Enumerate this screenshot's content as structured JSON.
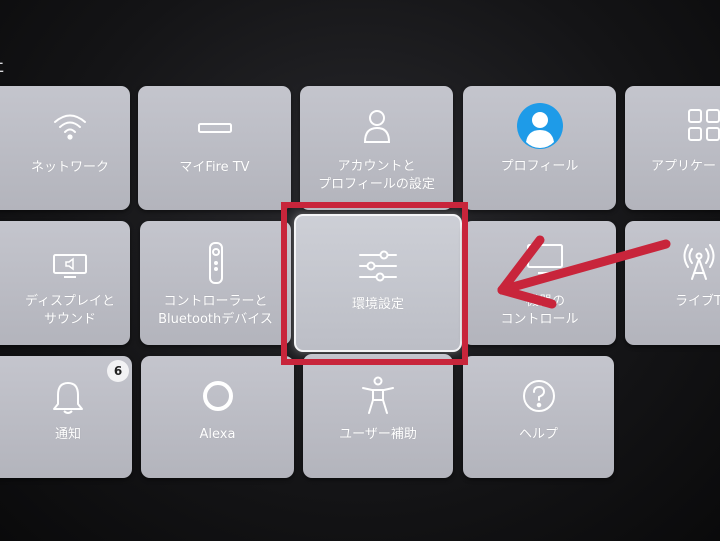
{
  "tiles": {
    "network": {
      "label": "ネットワーク",
      "icon": "wifi-icon"
    },
    "my_fire_tv": {
      "label": "マイFire TV",
      "icon": "fire-tv-stick-icon"
    },
    "account": {
      "label_line1": "アカウントと",
      "label_line2": "プロフィールの設定",
      "icon": "person-icon"
    },
    "profile": {
      "label": "プロフィール",
      "icon": "profile-avatar-icon"
    },
    "applications": {
      "label": "アプリケー",
      "icon": "apps-grid-icon"
    },
    "display_sound": {
      "label_line1": "ディスプレイと",
      "label_line2": "サウンド",
      "icon": "tv-speaker-icon"
    },
    "controllers": {
      "label_line1": "コントローラーと",
      "label_line2": "Bluetoothデバイス",
      "icon": "remote-icon"
    },
    "preferences": {
      "label": "環境設定",
      "icon": "sliders-icon"
    },
    "equipment_control": {
      "label_line1": "機器の",
      "label_line2": "コントロール",
      "icon": "tv-remote-icon"
    },
    "live_tv": {
      "label": "ライブT",
      "icon": "antenna-icon"
    },
    "notifications": {
      "label": "通知",
      "icon": "bell-icon",
      "badge": "6"
    },
    "alexa": {
      "label": "Alexa",
      "icon": "alexa-ring-icon"
    },
    "accessibility": {
      "label": "ユーザー補助",
      "icon": "accessibility-figure-icon"
    },
    "help": {
      "label": "ヘルプ",
      "icon": "help-question-icon"
    }
  },
  "annotation": {
    "highlight_color": "#c8253b",
    "arrow_color": "#c8253b",
    "focused_tile": "preferences"
  },
  "colors": {
    "tile_bg": "#bdbec6",
    "page_bg": "#141416",
    "profile_blue": "#1e9be8"
  }
}
